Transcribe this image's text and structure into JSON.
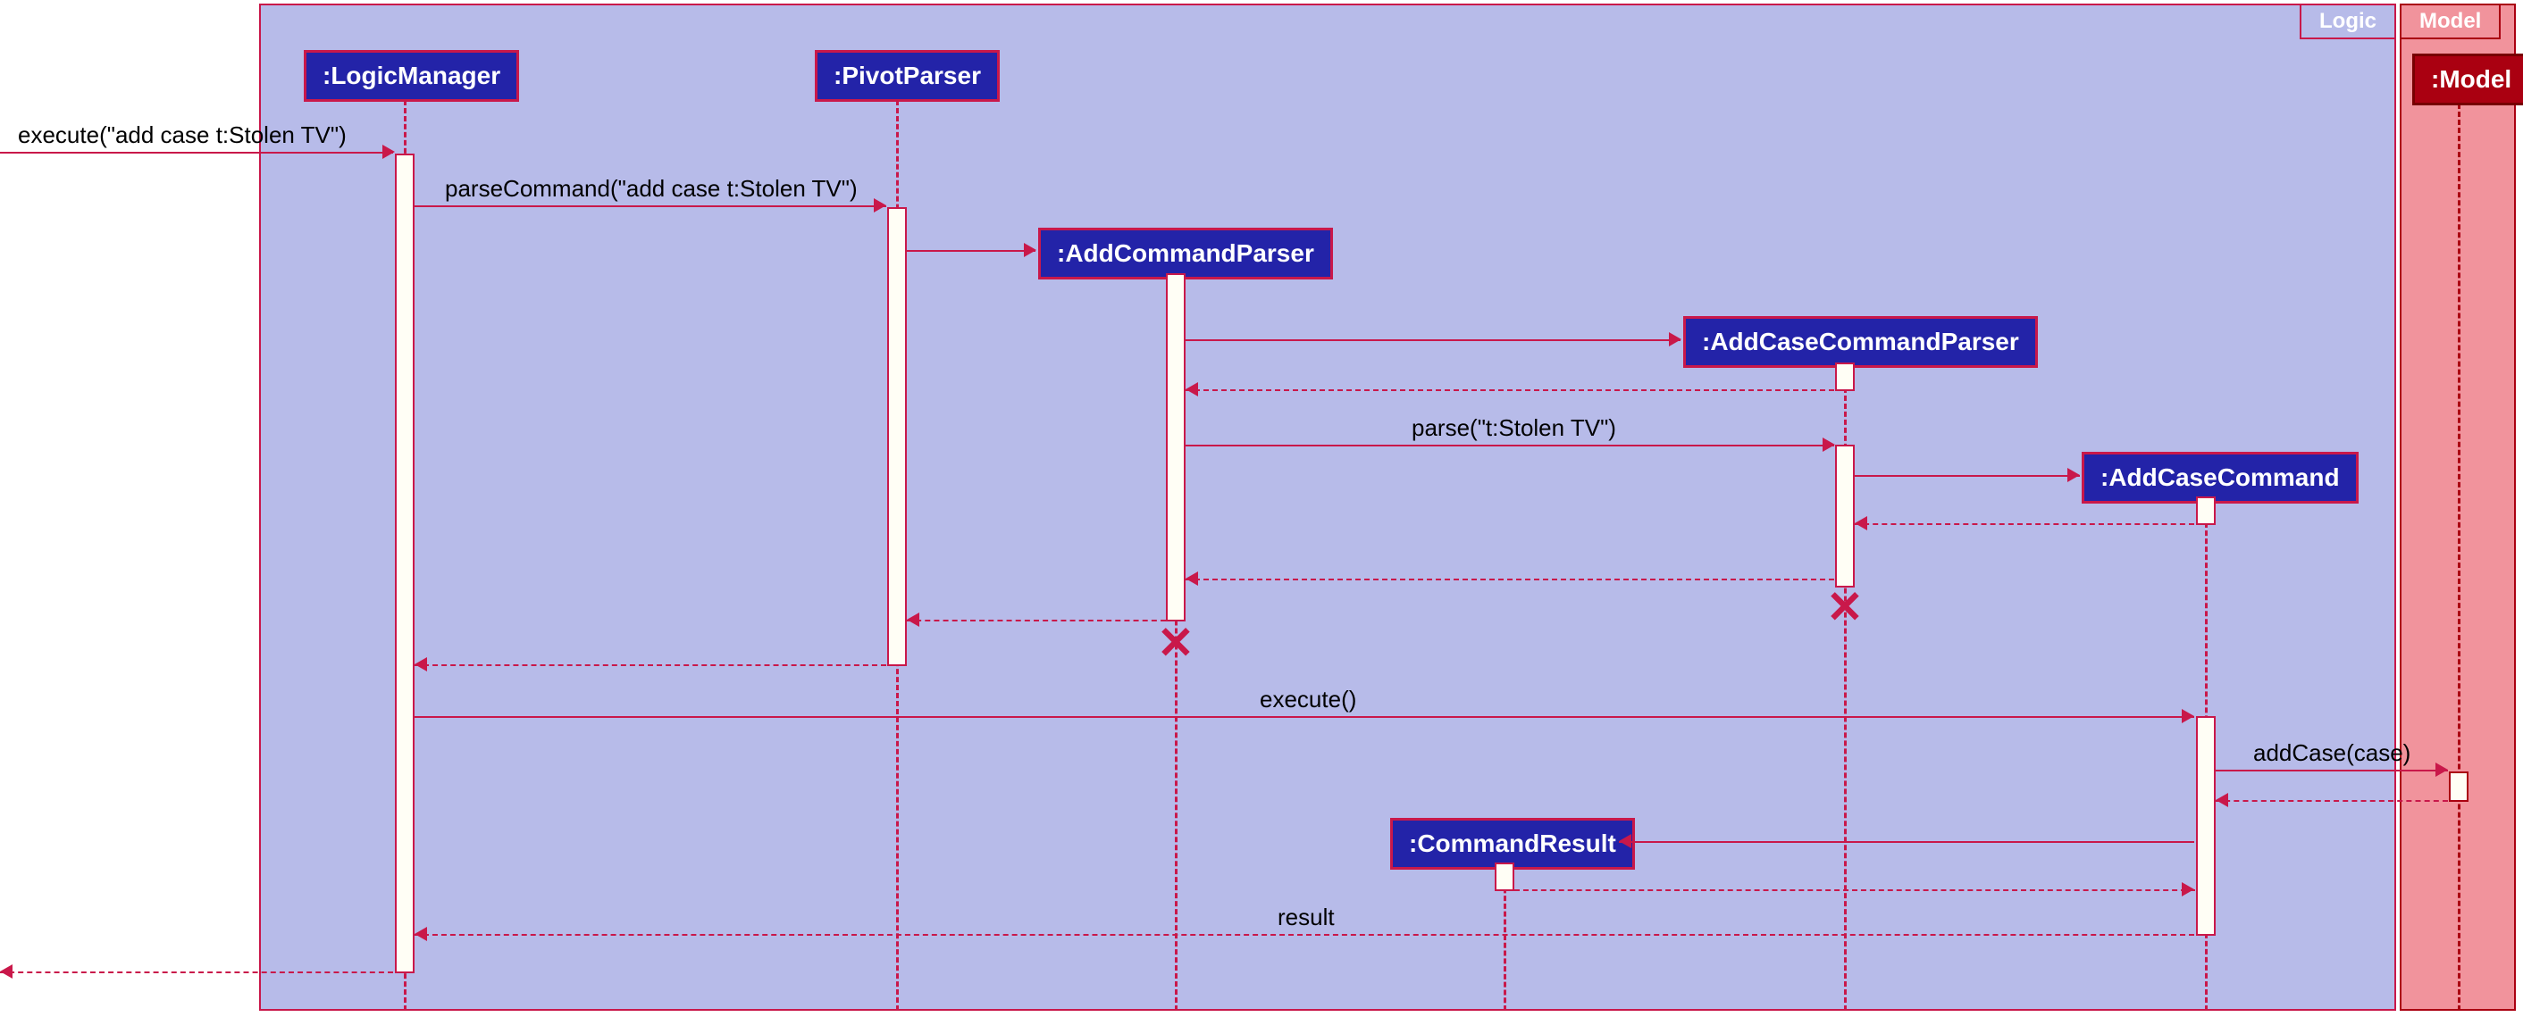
{
  "packages": {
    "logic": {
      "title": "Logic"
    },
    "model": {
      "title": "Model"
    }
  },
  "participants": {
    "logicManager": ":LogicManager",
    "pivotParser": ":PivotParser",
    "addCommandParser": ":AddCommandParser",
    "addCaseCommandParser": ":AddCaseCommandParser",
    "addCaseCommand": ":AddCaseCommand",
    "commandResult": ":CommandResult",
    "model": ":Model"
  },
  "messages": {
    "execute1": "execute(\"add case t:Stolen TV\")",
    "parseCommand": "parseCommand(\"add case t:Stolen TV\")",
    "parse": "parse(\"t:Stolen TV\")",
    "execute2": "execute()",
    "addCase": "addCase(case)",
    "result": "result"
  }
}
